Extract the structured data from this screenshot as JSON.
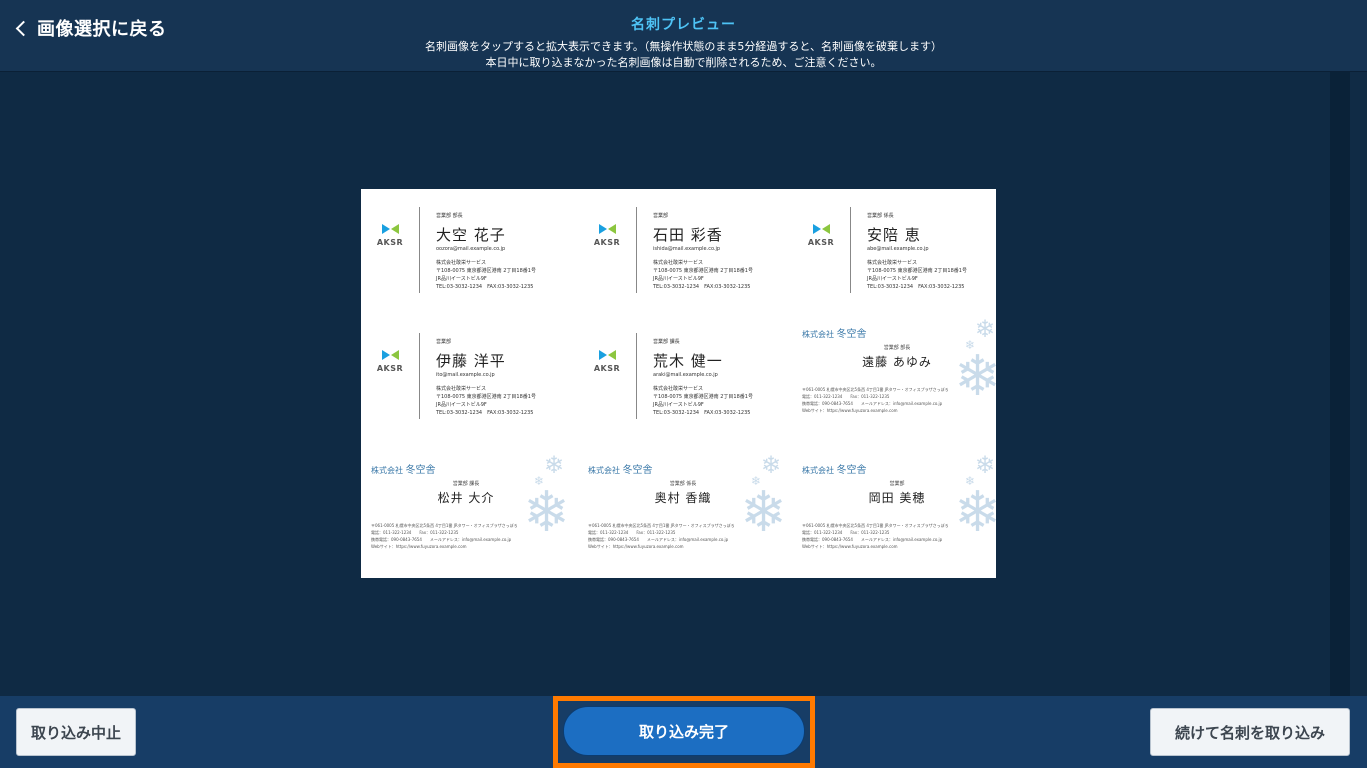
{
  "header": {
    "back_label": "画像選択に戻る",
    "title": "名刺プレビュー",
    "subtitle_line1": "名刺画像をタップすると拡大表示できます。（無操作状態のまま5分経過すると、名刺画像を破棄します）",
    "subtitle_line2": "本日中に取り込まなかった名刺画像は自動で削除されるため、ご注意ください。"
  },
  "preview": {
    "aksr_cards": [
      {
        "dept": "営業部 部長",
        "name": "大空 花子",
        "email": "oozora@mail.example.co.jp"
      },
      {
        "dept": "営業部",
        "name": "石田 彩香",
        "email": "ishida@mail.example.co.jp"
      },
      {
        "dept": "営業部 係長",
        "name": "安陪 恵",
        "email": "abe@mail.example.co.jp"
      },
      {
        "dept": "営業部",
        "name": "伊藤 洋平",
        "email": "ito@mail.example.co.jp"
      },
      {
        "dept": "営業部 課長",
        "name": "荒木 健一",
        "email": "araki@mail.example.co.jp"
      }
    ],
    "aksr_logo_text": "AKSR",
    "aksr_company": "株式会社敢栄サービス",
    "aksr_address1": "〒108-0075 東京都港区港南 2丁目18番1号",
    "aksr_address2": "JR品川イーストビル9F",
    "aksr_tel": "TEL:03-3032-1234　FAX:03-3032-1235",
    "winter_company_prefix": "株式会社",
    "winter_company_name": "冬空舎",
    "winter_cards": [
      {
        "title": "営業部 部長",
        "name": "遠藤 あゆみ"
      },
      {
        "title": "営業部 課長",
        "name": "松井 大介"
      },
      {
        "title": "営業部 係長",
        "name": "奥村 香織"
      },
      {
        "title": "営業部",
        "name": "岡田 美穂"
      }
    ],
    "winter_info1": "〒061-0005 札幌市中央区北5条西 4丁目1番 JRタワー・オフィスプラザさっぽろ",
    "winter_info2": "電話：011-322-1234　　Fax：011-322-1235",
    "winter_info3": "携帯電話：090-0843-7654　　メールアドレス：info@mail.example.co.jp",
    "winter_info4": "Webサイト：https://www.fuyuzora.example.com",
    "snowflake": "❄"
  },
  "footer": {
    "cancel_label": "取り込み中止",
    "complete_label": "取り込み完了",
    "continue_label": "続けて名刺を取り込み"
  },
  "colors": {
    "header_bg": "#163453",
    "content_bg": "#0f2a44",
    "footer_bg": "#173d66",
    "title": "#4ec3f5",
    "primary_button": "#1c6ec2",
    "highlight": "#ff7a00"
  }
}
